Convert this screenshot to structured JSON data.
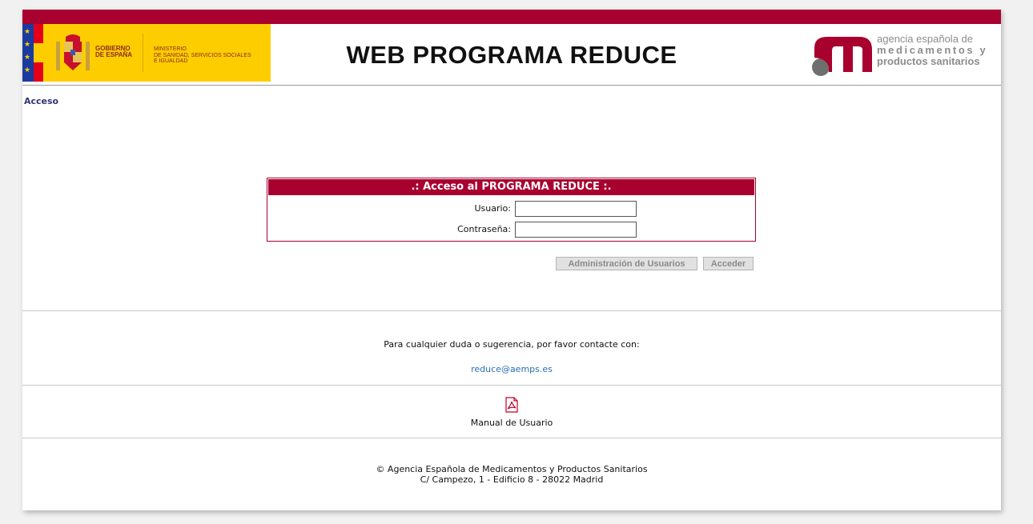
{
  "header": {
    "gov_line1": "GOBIERNO",
    "gov_line2": "DE ESPAÑA",
    "ministry_line1": "MINISTERIO",
    "ministry_line2": "DE SANIDAD, SERVICIOS SOCIALES",
    "ministry_line3": "E IGUALDAD",
    "site_title": "WEB PROGRAMA REDUCE",
    "aemps_line1": "agencia española de",
    "aemps_line2": "medicamentos y",
    "aemps_line3": "productos sanitarios"
  },
  "breadcrumb": "Acceso",
  "login": {
    "title": ".: Acceso al PROGRAMA REDUCE :.",
    "user_label": "Usuario:",
    "user_value": "",
    "password_label": "Contraseña:",
    "password_value": ""
  },
  "buttons": {
    "admin": "Administración de Usuarios",
    "access": "Acceder"
  },
  "contact": {
    "text": "Para cualquier duda o sugerencia, por favor contacte con:",
    "email": "reduce@aemps.es"
  },
  "manual": {
    "label": "Manual de Usuario",
    "icon": "pdf-icon"
  },
  "footer": {
    "line1": "© Agencia Española de Medicamentos y Productos Sanitarios",
    "line2": "C/ Campezo, 1 - Edificio 8 - 28022 Madrid"
  },
  "colors": {
    "brand": "#a8002f",
    "gov_yellow": "#fecd00",
    "link": "#2c6fb3"
  }
}
